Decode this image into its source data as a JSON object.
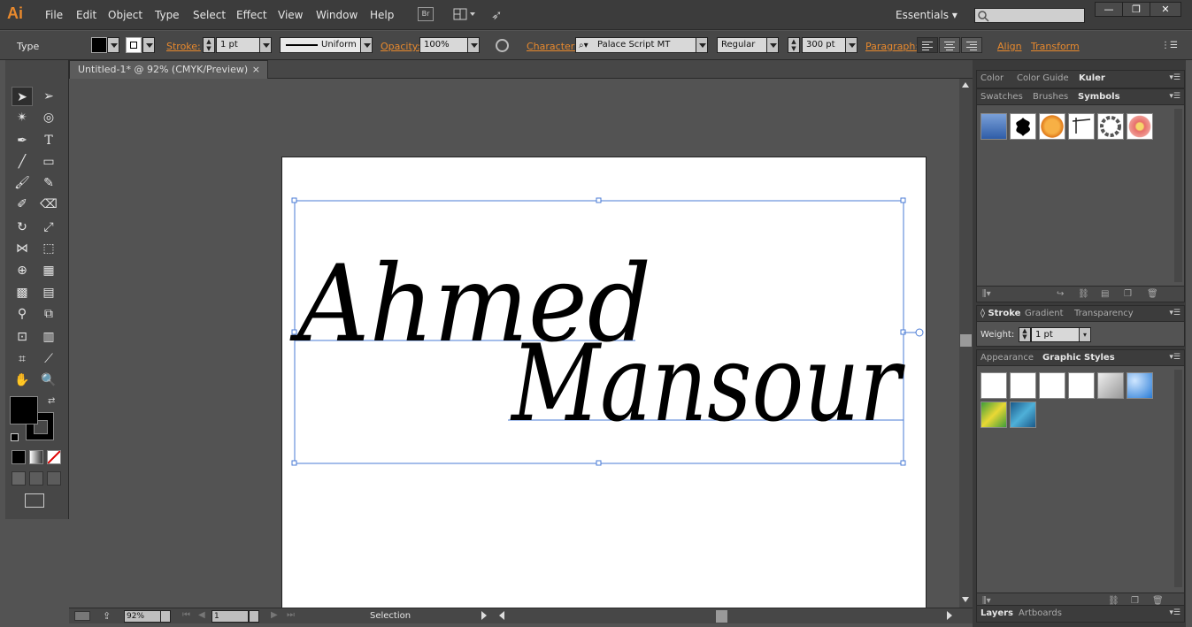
{
  "app": {
    "logo": "Ai",
    "menus": [
      "File",
      "Edit",
      "Object",
      "Type",
      "Select",
      "Effect",
      "View",
      "Window",
      "Help"
    ],
    "bridge_label": "Br",
    "workspace": "Essentials"
  },
  "control_bar": {
    "tool_name": "Type",
    "stroke_label": "Stroke:",
    "stroke_value": "1 pt",
    "stroke_profile": "Uniform",
    "opacity_label": "Opacity:",
    "opacity_value": "100%",
    "character_label": "Character:",
    "font_family": "Palace Script MT",
    "font_style": "Regular",
    "font_size": "300 pt",
    "paragraph_label": "Paragraph:",
    "align_label": "Align",
    "transform_label": "Transform"
  },
  "document": {
    "tab_title": "Untitled-1* @ 92% (CMYK/Preview)",
    "close_glyph": "×",
    "line1": "Ahmed",
    "line2": "Mansour"
  },
  "status_bar": {
    "zoom": "92%",
    "page": "1",
    "mode": "Selection"
  },
  "panels": {
    "color_tabs": [
      "Color",
      "Color Guide",
      "Kuler"
    ],
    "symbol_tabs": [
      "Swatches",
      "Brushes",
      "Symbols"
    ],
    "stroke_tabs": [
      "Stroke",
      "Gradient",
      "Transparency"
    ],
    "stroke_weight_label": "Weight:",
    "stroke_weight_value": "1 pt",
    "appearance_tabs": [
      "Appearance",
      "Graphic Styles"
    ],
    "layers_tabs": [
      "Layers",
      "Artboards"
    ]
  },
  "colors": {
    "accent_orange": "#e8892d",
    "selection_blue": "#4a7bd6"
  }
}
